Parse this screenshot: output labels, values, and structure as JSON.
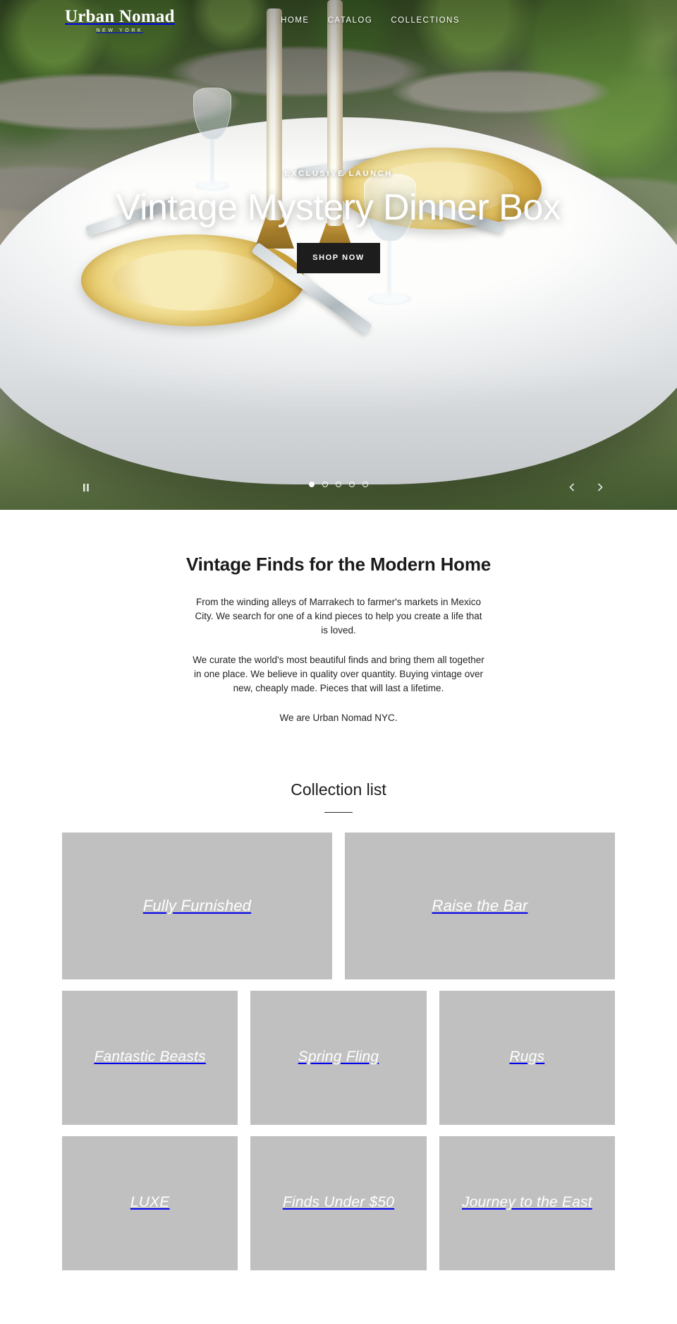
{
  "header": {
    "brand_name": "Urban Nomad",
    "brand_sub": "NEW YORK",
    "nav": [
      {
        "label": "HOME"
      },
      {
        "label": "CATALOG"
      },
      {
        "label": "COLLECTIONS"
      }
    ]
  },
  "hero": {
    "eyebrow": "EXCLUSIVE LAUNCH",
    "title": "Vintage Mystery Dinner Box",
    "cta_label": "SHOP NOW",
    "pause_icon": "pause-icon",
    "prev_icon": "prev-arrow-icon",
    "next_icon": "next-arrow-icon",
    "slide_count": 5,
    "active_slide": 1
  },
  "intro": {
    "title": "Vintage Finds for the Modern Home",
    "paragraphs": [
      "From the winding alleys of Marrakech to farmer's markets in Mexico City. We search for one of a kind pieces to help you create a life that is loved.",
      "We curate the world's most beautiful finds and bring them all together in one place. We believe in quality over quantity. Buying vintage over new, cheaply made. Pieces that will last a lifetime.",
      "We are Urban Nomad NYC."
    ]
  },
  "collections": {
    "title": "Collection list",
    "rows": [
      {
        "tiles": [
          {
            "label": "Fully Furnished"
          },
          {
            "label": "Raise the Bar"
          }
        ]
      },
      {
        "tiles": [
          {
            "label": "Fantastic Beasts"
          },
          {
            "label": "Spring Fling"
          },
          {
            "label": "Rugs"
          }
        ]
      },
      {
        "tiles": [
          {
            "label": "LUXE"
          },
          {
            "label": "Finds Under $50"
          },
          {
            "label": "Journey to the East"
          }
        ]
      }
    ]
  },
  "colors": {
    "cta_background": "#1d1d1d",
    "tile_placeholder": "#c0c0c0",
    "text_primary": "#1b1b1b",
    "on_dark_text": "#ffffff"
  }
}
